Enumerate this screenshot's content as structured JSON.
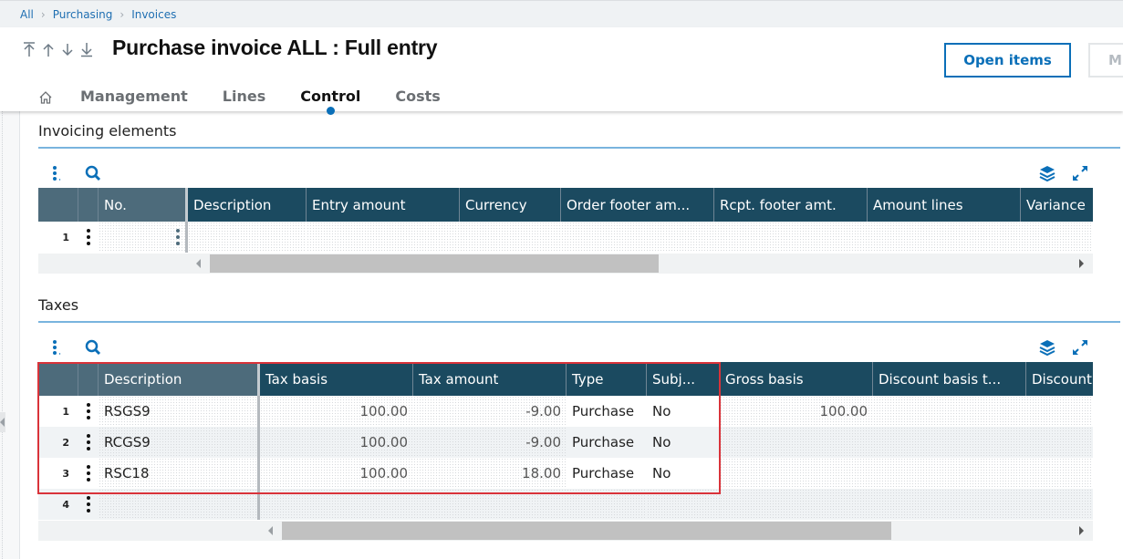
{
  "breadcrumb": [
    "All",
    "Purchasing",
    "Invoices"
  ],
  "header": {
    "title": "Purchase invoice ALL : Full entry",
    "nav_arrows": [
      "first-record-icon",
      "previous-record-icon",
      "next-record-icon",
      "last-record-icon"
    ],
    "buttons": {
      "open_items": "Open items",
      "more": "M"
    }
  },
  "tabs": [
    {
      "label": "Management",
      "active": false
    },
    {
      "label": "Lines",
      "active": false
    },
    {
      "label": "Control",
      "active": true
    },
    {
      "label": "Costs",
      "active": false
    }
  ],
  "invoicing_elements": {
    "title": "Invoicing elements",
    "columns": [
      "No.",
      "Description",
      "Entry amount",
      "Currency",
      "Order footer am...",
      "Rcpt. footer amt.",
      "Amount lines",
      "Variance"
    ],
    "rows": [
      {
        "row_number": "1",
        "no": "",
        "description": "",
        "entry_amount": "",
        "currency": "",
        "order_footer_amt": "",
        "rcpt_footer_amt": "",
        "amount_lines": "",
        "variance": ""
      }
    ],
    "scrollbar": {
      "position": 0,
      "visible_fraction": 0.52
    }
  },
  "taxes": {
    "title": "Taxes",
    "columns": [
      "Description",
      "Tax basis",
      "Tax amount",
      "Type",
      "Subj...",
      "Gross basis",
      "Discount basis t...",
      "Discount"
    ],
    "rows": [
      {
        "row_number": "1",
        "description": "RSGS9",
        "tax_basis": "100.00",
        "tax_amount": "-9.00",
        "type": "Purchase",
        "subject": "No",
        "gross_basis": "100.00",
        "discount_basis": "",
        "discount": ""
      },
      {
        "row_number": "2",
        "description": "RCGS9",
        "tax_basis": "100.00",
        "tax_amount": "-9.00",
        "type": "Purchase",
        "subject": "No",
        "gross_basis": "",
        "discount_basis": "",
        "discount": ""
      },
      {
        "row_number": "3",
        "description": "RSC18",
        "tax_basis": "100.00",
        "tax_amount": "18.00",
        "type": "Purchase",
        "subject": "No",
        "gross_basis": "",
        "discount_basis": "",
        "discount": ""
      },
      {
        "row_number": "4",
        "description": "",
        "tax_basis": "",
        "tax_amount": "",
        "type": "",
        "subject": "",
        "gross_basis": "",
        "discount_basis": "",
        "discount": ""
      }
    ],
    "scrollbar": {
      "position": 0,
      "visible_fraction": 0.77
    }
  },
  "colors": {
    "accent": "#0a6fb8",
    "header_fixed": "#4d6b7b",
    "header_scroll": "#1b4a60",
    "highlight": "#d9333a",
    "section_line": "#79b4de"
  }
}
